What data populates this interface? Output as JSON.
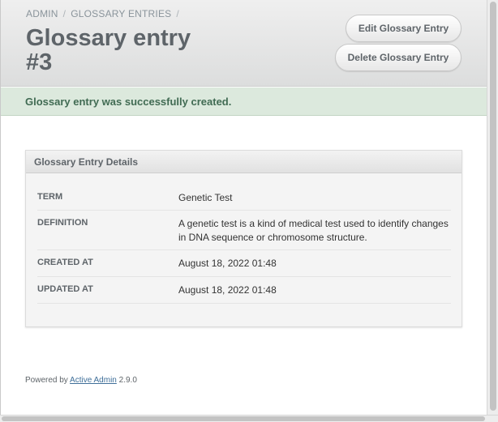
{
  "breadcrumb": [
    "ADMIN",
    "GLOSSARY ENTRIES"
  ],
  "breadcrumb_sep": "/",
  "page_title": "Glossary entry #3",
  "actions": {
    "edit": "Edit Glossary Entry",
    "delete": "Delete Glossary Entry"
  },
  "flash": "Glossary entry was successfully created.",
  "panel": {
    "title": "Glossary Entry Details",
    "rows": [
      {
        "label": "TERM",
        "value": "Genetic Test"
      },
      {
        "label": "DEFINITION",
        "value": "A genetic test is a kind of medical test used to identify changes in DNA sequence or chromosome structure."
      },
      {
        "label": "CREATED AT",
        "value": "August 18, 2022 01:48"
      },
      {
        "label": "UPDATED AT",
        "value": "August 18, 2022 01:48"
      }
    ]
  },
  "footer": {
    "prefix": "Powered by",
    "link": "Active Admin",
    "version": "2.9.0"
  },
  "colors": {
    "header_text": "#5e6469",
    "flash_bg": "#dce9dd",
    "flash_text": "#416b53",
    "link": "#3f6f99"
  }
}
